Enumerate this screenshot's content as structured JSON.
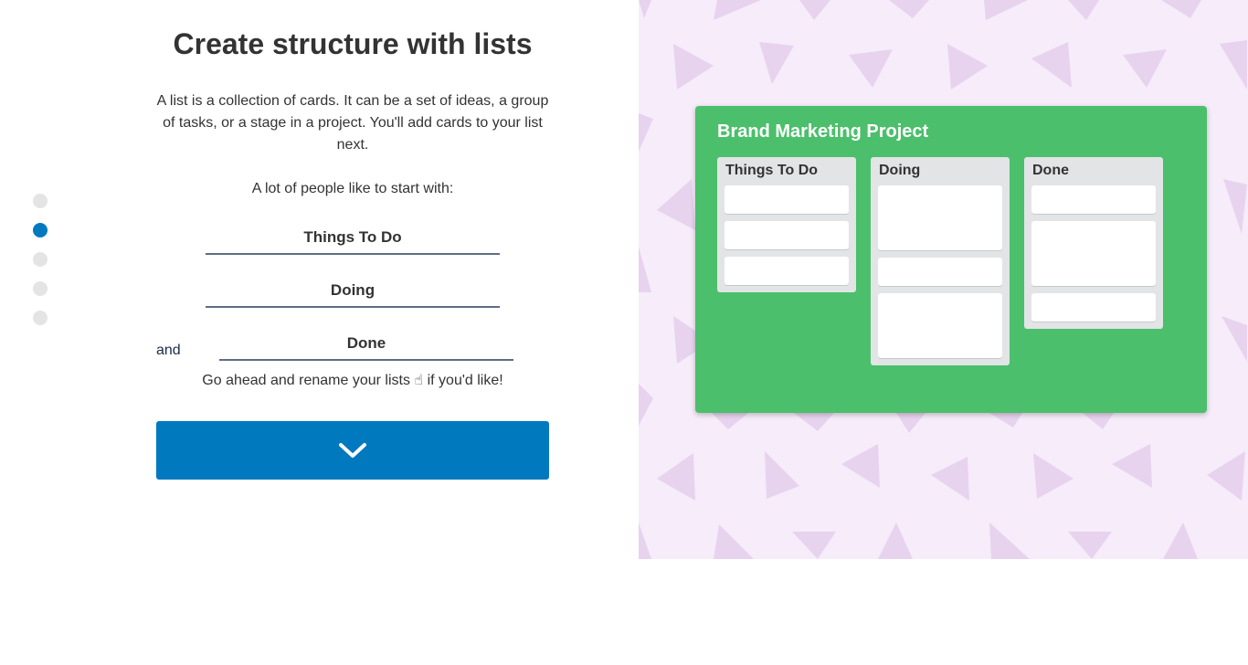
{
  "onboarding": {
    "title": "Create structure with lists",
    "description": "A list is a collection of cards. It can be a set of ideas, a group of tasks, or a stage in a project. You'll add cards to your list next.",
    "lead": "A lot of people like to start with:",
    "list_inputs": [
      "Things To Do",
      "Doing",
      "Done"
    ],
    "and_label": "and",
    "hint": "Go ahead and rename your lists ☝ if you'd like!",
    "next_icon": "chevron-down-icon",
    "steps": {
      "total": 5,
      "active": 2
    }
  },
  "preview": {
    "board_title": "Brand Marketing Project",
    "lists": [
      {
        "title": "Things To Do",
        "cards": [
          "small",
          "small",
          "small"
        ]
      },
      {
        "title": "Doing",
        "cards": [
          "large",
          "small",
          "large"
        ]
      },
      {
        "title": "Done",
        "cards": [
          "small",
          "large",
          "small"
        ]
      }
    ]
  },
  "colors": {
    "accent": "#0079bf",
    "board": "#4bbf6b",
    "background_pattern": "#f6ecfa",
    "triangle": "#e8d3ef",
    "inactive_dot": "#e4e4e4"
  }
}
